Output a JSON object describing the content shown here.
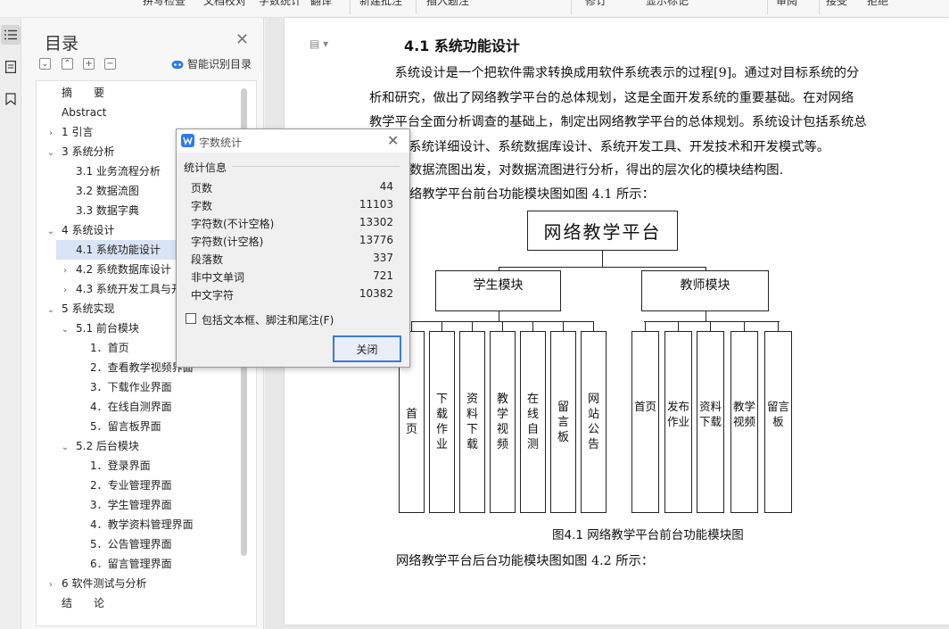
{
  "toolbar": {
    "items": [
      "拼写检查",
      "文档校对",
      "字数统计",
      "翻译",
      "新建批注",
      "插入题注",
      "修订",
      "显示标记",
      "审阅",
      "接受",
      "拒绝"
    ]
  },
  "nav": {
    "title": "目录",
    "smart_toc_label": "智能识别目录",
    "items": [
      {
        "text": "摘　　要",
        "level": 0,
        "arrow": ""
      },
      {
        "text": "Abstract",
        "level": 0,
        "arrow": ""
      },
      {
        "text": "1 引言",
        "level": 0,
        "arrow": "›"
      },
      {
        "text": "3 系统分析",
        "level": 0,
        "arrow": "⌄"
      },
      {
        "text": "3.1 业务流程分析",
        "level": 1,
        "arrow": ""
      },
      {
        "text": "3.2 数据流图",
        "level": 1,
        "arrow": ""
      },
      {
        "text": "3.3 数据字典",
        "level": 1,
        "arrow": ""
      },
      {
        "text": "4 系统设计",
        "level": 0,
        "arrow": "⌄"
      },
      {
        "text": "4.1 系统功能设计",
        "level": 1,
        "arrow": "",
        "selected": true
      },
      {
        "text": "4.2 系统数据库设计",
        "level": 1,
        "arrow": "›"
      },
      {
        "text": "4.3 系统开发工具与开",
        "level": 1,
        "arrow": "›"
      },
      {
        "text": "5 系统实现",
        "level": 0,
        "arrow": "⌄"
      },
      {
        "text": "5.1 前台模块",
        "level": 1,
        "arrow": "⌄"
      },
      {
        "text": "1．首页",
        "level": 2,
        "arrow": ""
      },
      {
        "text": "2．查看教学视频界面",
        "level": 2,
        "arrow": ""
      },
      {
        "text": "3．下载作业界面",
        "level": 2,
        "arrow": ""
      },
      {
        "text": "4．在线自测界面",
        "level": 2,
        "arrow": ""
      },
      {
        "text": "5．留言板界面",
        "level": 2,
        "arrow": ""
      },
      {
        "text": "5.2 后台模块",
        "level": 1,
        "arrow": "⌄"
      },
      {
        "text": "1．登录界面",
        "level": 2,
        "arrow": ""
      },
      {
        "text": "2．专业管理界面",
        "level": 2,
        "arrow": ""
      },
      {
        "text": "3．学生管理界面",
        "level": 2,
        "arrow": ""
      },
      {
        "text": "4．教学资料管理界面",
        "level": 2,
        "arrow": ""
      },
      {
        "text": "5．公告管理界面",
        "level": 2,
        "arrow": ""
      },
      {
        "text": "6．留言管理界面",
        "level": 2,
        "arrow": ""
      },
      {
        "text": "6 软件测试与分析",
        "level": 0,
        "arrow": "›"
      },
      {
        "text": "结　　论",
        "level": 0,
        "arrow": ""
      }
    ]
  },
  "document": {
    "heading": "4.1 系统功能设计",
    "lines": [
      "　　系统设计是一个把软件需求转换成用软件系统表示的过程[9]。通过对目标系统的分",
      "析和研究，做出了网络教学平台的总体规划，这是全面开发系统的重要基础。在对网络",
      "教学平台全面分析调查的基础上，制定出网络教学平台的总体规划。系统设计包括系统总",
      "、系统详细设计、系统数据库设计、系统开发工具、开发技术和开发模式等。",
      "数据流图出发，对数据流图进行分析，得出的层次化的模块结构图.",
      "络教学平台前台功能模块图如图 4.1 所示："
    ],
    "caption": "图4.1  网络教学平台前台功能模块图",
    "after": "网络教学平台后台功能模块图如图 4.2 所示："
  },
  "diagram": {
    "root": "网络教学平台",
    "student": "学生模块",
    "teacher": "教师模块",
    "student_leaves": [
      "首\n页",
      "下\n载\n作\n业",
      "资\n料\n下\n载",
      "教\n学\n视\n频",
      "在\n线\n自\n测",
      "留\n言\n板",
      "网\n站\n公\n告"
    ],
    "teacher_leaves": [
      "首页",
      "发布\n作业",
      "资料\n下载",
      "教学\n视频",
      "留言\n板"
    ]
  },
  "dialog": {
    "title": "字数统计",
    "group": "统计信息",
    "rows": [
      {
        "label": "页数",
        "value": "44"
      },
      {
        "label": "字数",
        "value": "11103"
      },
      {
        "label": "字符数(不计空格)",
        "value": "13302"
      },
      {
        "label": "字符数(计空格)",
        "value": "13776"
      },
      {
        "label": "段落数",
        "value": "337"
      },
      {
        "label": "非中文单词",
        "value": "721"
      },
      {
        "label": "中文字符",
        "value": "10382"
      }
    ],
    "checkbox_label": "包括文本框、脚注和尾注(F)",
    "checkbox_checked": false,
    "close_label": "关闭"
  },
  "colors": {
    "selection": "#d9e4f5",
    "accent": "#3a7bd5",
    "wps_blue": "#2f7be6"
  }
}
